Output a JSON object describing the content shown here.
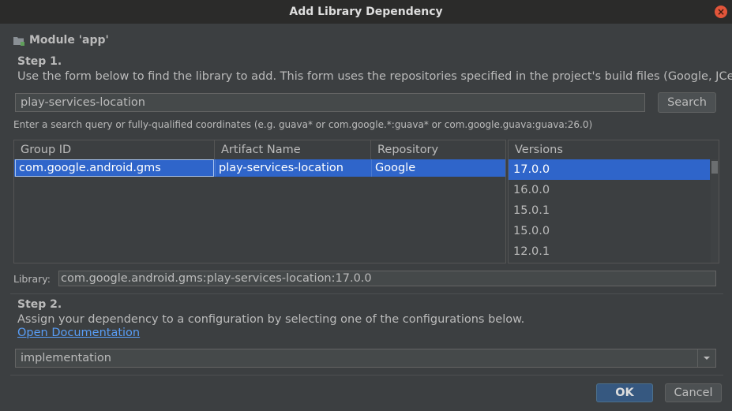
{
  "window": {
    "title": "Add Library Dependency"
  },
  "module": {
    "label": "Module 'app'"
  },
  "step1": {
    "title": "Step 1.",
    "description": "Use the form below to find the library to add. This form uses the repositories specified in the project's build files (Google, JCenter)"
  },
  "search": {
    "value": "play-services-location",
    "button_label": "Search",
    "hint": "Enter a search query or fully-qualified coordinates (e.g. guava* or com.google.*:guava* or com.google.guava:guava:26.0)"
  },
  "results": {
    "columns": [
      "Group ID",
      "Artifact Name",
      "Repository"
    ],
    "rows": [
      {
        "group_id": "com.google.android.gms",
        "artifact": "play-services-location",
        "repository": "Google"
      }
    ]
  },
  "versions": {
    "header": "Versions",
    "items": [
      "17.0.0",
      "16.0.0",
      "15.0.1",
      "15.0.0",
      "12.0.1"
    ],
    "selected": "17.0.0"
  },
  "library": {
    "label": "Library:",
    "value": "com.google.android.gms:play-services-location:17.0.0"
  },
  "step2": {
    "title": "Step 2.",
    "description": "Assign your dependency to a configuration by selecting one of the configurations below.",
    "link": "Open Documentation"
  },
  "configuration": {
    "selected": "implementation"
  },
  "footer": {
    "ok_label": "OK",
    "cancel_label": "Cancel"
  },
  "colors": {
    "background": "#3c3f41",
    "selection": "#2f65ca",
    "link": "#589df6",
    "close": "#e2553a"
  }
}
